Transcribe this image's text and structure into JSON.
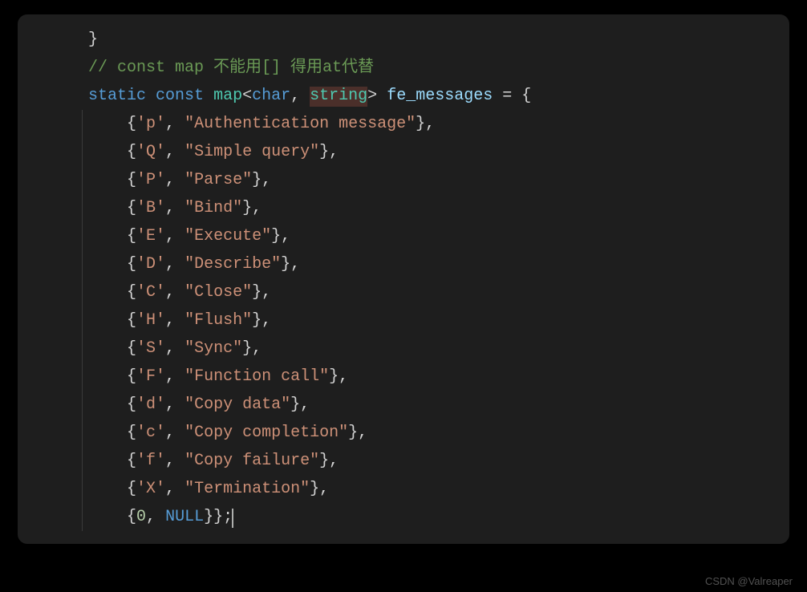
{
  "code": {
    "line0_brace": "}",
    "comment": "// const map 不能用[] 得用at代替",
    "decl": {
      "kw_static": "static",
      "kw_const": "const",
      "type_map": "map",
      "lt": "<",
      "type_char": "char",
      "comma": ", ",
      "type_string": "string",
      "gt": ">",
      "ident": "fe_messages",
      "assign": " = {"
    },
    "entries": [
      {
        "key": "'p'",
        "value": "\"Authentication message\""
      },
      {
        "key": "'Q'",
        "value": "\"Simple query\""
      },
      {
        "key": "'P'",
        "value": "\"Parse\""
      },
      {
        "key": "'B'",
        "value": "\"Bind\""
      },
      {
        "key": "'E'",
        "value": "\"Execute\""
      },
      {
        "key": "'D'",
        "value": "\"Describe\""
      },
      {
        "key": "'C'",
        "value": "\"Close\""
      },
      {
        "key": "'H'",
        "value": "\"Flush\""
      },
      {
        "key": "'S'",
        "value": "\"Sync\""
      },
      {
        "key": "'F'",
        "value": "\"Function call\""
      },
      {
        "key": "'d'",
        "value": "\"Copy data\""
      },
      {
        "key": "'c'",
        "value": "\"Copy completion\""
      },
      {
        "key": "'f'",
        "value": "\"Copy failure\""
      },
      {
        "key": "'X'",
        "value": "\"Termination\""
      }
    ],
    "last": {
      "zero": "0",
      "null": "NULL",
      "tail": "}};"
    }
  },
  "watermark": "CSDN @Valreaper"
}
